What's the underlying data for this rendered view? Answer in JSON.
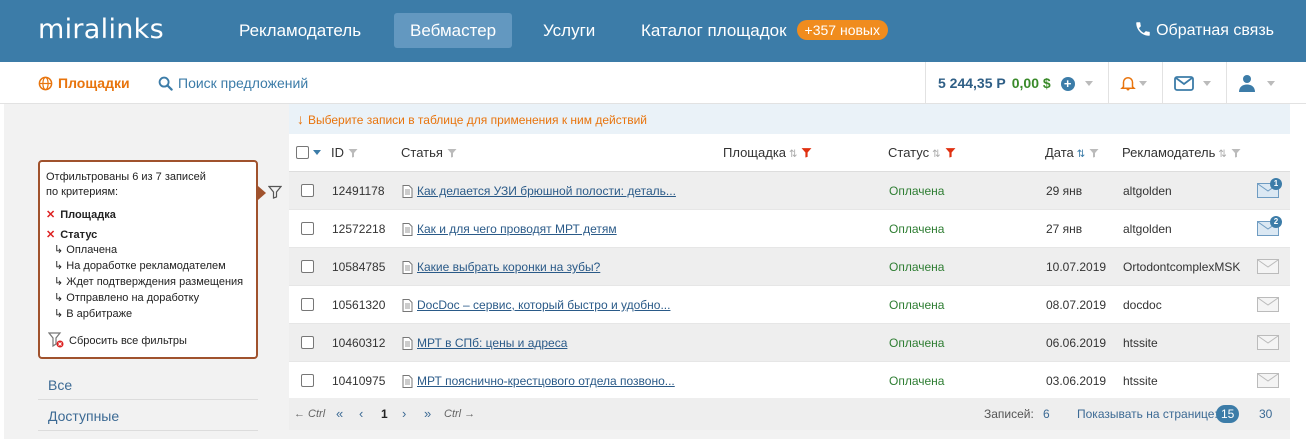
{
  "header": {
    "logo": "miralinks",
    "nav": [
      {
        "label": "Рекламодатель",
        "active": false
      },
      {
        "label": "Вебмастер",
        "active": true
      },
      {
        "label": "Услуги",
        "active": false
      },
      {
        "label": "Каталог площадок",
        "active": false
      }
    ],
    "catalog_badge": "+357 новых",
    "feedback": "Обратная связь"
  },
  "subheader": {
    "sites": "Площадки",
    "search_offers": "Поиск предложений",
    "balance_rub": "5 244,35 Р",
    "balance_usd": "0,00 $"
  },
  "hint": "Выберите записи в таблице для применения к ним действий",
  "filter_panel": {
    "summary_line1": "Отфильтрованы 6 из 7 записей",
    "summary_line2": "по критериям:",
    "criteria": [
      {
        "name": "Площадка",
        "values": []
      },
      {
        "name": "Статус",
        "values": [
          "Оплачена",
          "На доработке рекламодателем",
          "Ждет подтверждения размещения",
          "Отправлено на доработку",
          "В арбитраже"
        ]
      }
    ],
    "reset": "Сбросить все фильтры"
  },
  "sidebar": {
    "links": [
      "Все",
      "Доступные"
    ]
  },
  "table": {
    "columns": {
      "id": "ID",
      "article": "Статья",
      "site": "Площадка",
      "status": "Статус",
      "date": "Дата",
      "advertiser": "Рекламодатель"
    },
    "rows": [
      {
        "id": "12491178",
        "article": "Как делается УЗИ брюшной полости: деталь...",
        "status": "Оплачена",
        "date": "29 янв",
        "advertiser": "altgolden",
        "badge": "1"
      },
      {
        "id": "12572218",
        "article": "Как и для чего проводят МРТ детям",
        "status": "Оплачена",
        "date": "27 янв",
        "advertiser": "altgolden",
        "badge": "2"
      },
      {
        "id": "10584785",
        "article": "Какие выбрать коронки на зубы?",
        "status": "Оплачена",
        "date": "10.07.2019",
        "advertiser": "OrtodontcomplexMSK",
        "badge": ""
      },
      {
        "id": "10561320",
        "article": "DocDoc – сервис, который быстро и удобно...",
        "status": "Оплачена",
        "date": "08.07.2019",
        "advertiser": "docdoc",
        "badge": ""
      },
      {
        "id": "10460312",
        "article": "МРТ в СПб: цены и адреса",
        "status": "Оплачена",
        "date": "06.06.2019",
        "advertiser": "htssite",
        "badge": ""
      },
      {
        "id": "10410975",
        "article": "МРТ пояснично-крестцового отдела позвоно...",
        "status": "Оплачена",
        "date": "03.06.2019",
        "advertiser": "htssite",
        "badge": ""
      }
    ]
  },
  "pagination": {
    "prev_ctrl": "← Ctrl",
    "first": "«",
    "prev": "‹",
    "current": "1",
    "next": "›",
    "last": "»",
    "next_ctrl": "Ctrl →",
    "records_label": "Записей:",
    "records_count": "6",
    "per_page_label": "Показывать на странице:",
    "per_page_options": [
      "15",
      "30"
    ],
    "per_page_selected": "15"
  },
  "colors": {
    "header_bg": "#3c7ca8",
    "accent_orange": "#e8740d",
    "status_green": "#2e7d32",
    "filter_border": "#a0522d"
  }
}
